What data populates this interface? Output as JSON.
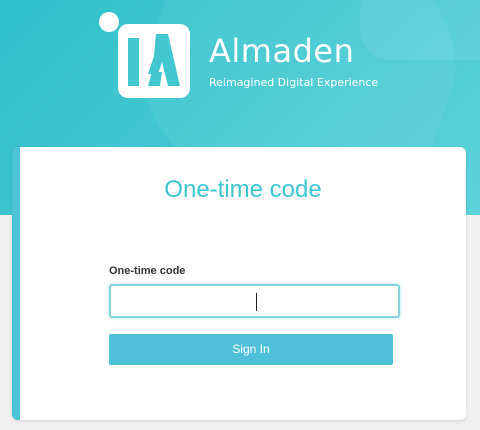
{
  "brand": {
    "name": "Almaden",
    "tagline": "Reimagined Digital Experience",
    "logo_icon": "almaden-logo-icon"
  },
  "colors": {
    "hero": "#42c7d1",
    "accent": "#3cc6d2",
    "button": "#4ec0d9",
    "card_border": "#4cc3d6"
  },
  "login": {
    "title": "One-time code",
    "code_label": "One-time code",
    "code_value": "",
    "sign_in_label": "Sign In"
  }
}
